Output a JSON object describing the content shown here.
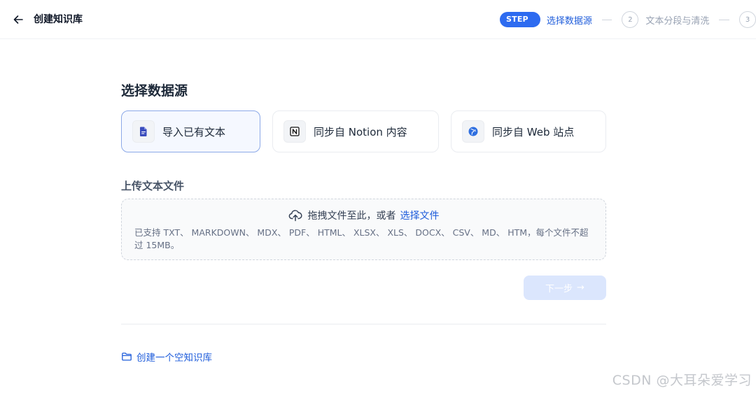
{
  "header": {
    "title": "创建知识库",
    "steps": [
      {
        "badge": "STEP 1",
        "label": "选择数据源"
      },
      {
        "num": "2",
        "label": "文本分段与清洗"
      },
      {
        "num": "3"
      }
    ]
  },
  "main": {
    "section_title": "选择数据源",
    "sources": [
      {
        "label": "导入已有文本",
        "icon": "document-icon",
        "active": true
      },
      {
        "label": "同步自 Notion 内容",
        "icon": "notion-icon",
        "active": false
      },
      {
        "label": "同步自 Web 站点",
        "icon": "globe-icon",
        "active": false
      }
    ],
    "upload": {
      "title": "上传文本文件",
      "drop_text": "拖拽文件至此，或者",
      "select_link": "选择文件",
      "support_text": "已支持 TXT、 MARKDOWN、 MDX、 PDF、 HTML、 XLSX、 XLS、 DOCX、 CSV、 MD、 HTM，每个文件不超过 15MB。"
    },
    "next_button": {
      "label": "下一步",
      "arrow": "→"
    },
    "empty_link": "创建一个空知识库"
  },
  "watermark": "CSDN @大耳朵爱学习",
  "colors": {
    "accent": "#2d6bf0",
    "link": "#1f5ddb",
    "active_card_bg": "#f5f8ff",
    "disabled_button": "#dbe6fd"
  }
}
